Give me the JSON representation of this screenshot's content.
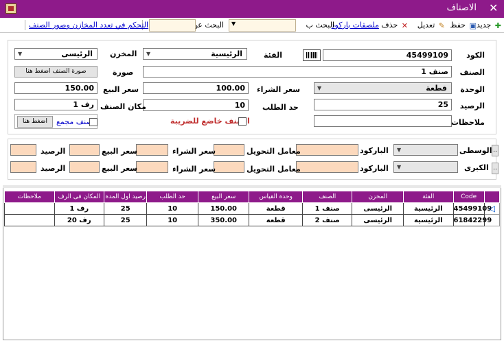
{
  "window": {
    "title": "الاصناف"
  },
  "toolbar": {
    "new": "جديد",
    "save": "حفظ",
    "edit": "تعديل",
    "delete": "حذف",
    "barcode_labels": "ملصقات باركود",
    "search_by": "البحث ب",
    "search_for": "البحث عن",
    "warehouse_control": "التحكم في تعدد المخازن وصور الصنف"
  },
  "form": {
    "code_label": "الكود",
    "code_value": "45499109",
    "category_label": "الفئة",
    "category_value": "الرئيسية",
    "store_label": "المخزن",
    "store_value": "الرئيسى",
    "item_label": "الصنف",
    "item_value": "صنف 1",
    "image_label": "صورة",
    "image_button": "صورة الصنف اضغط هنا",
    "unit_label": "الوحدة",
    "unit_value": "قطعة",
    "purchase_label": "سعر الشراء",
    "purchase_value": "100.00",
    "sale_label": "سعر البيع",
    "sale_value": "150.00",
    "balance_label": "الرصيد",
    "balance_value": "25",
    "reorder_label": "حد الطلب",
    "reorder_value": "10",
    "location_label": "مكان الصنف",
    "location_value": "رف 1",
    "notes_label": "ملاحظات",
    "notes_value": "",
    "taxable_label": "الصنف خاضع للضريبة",
    "compound_label": "صنف مجمع",
    "click_here": "اضغط هنا"
  },
  "units": [
    {
      "name": "الوسطى",
      "barcode_label": "الباركود",
      "factor_label": "معامل التحويل",
      "purchase_label": "سعر الشراء",
      "sale_label": "سعر البيع",
      "balance_label": "الرصيد"
    },
    {
      "name": "الكبرى",
      "barcode_label": "الباركود",
      "factor_label": "معامل التحويل",
      "purchase_label": "سعر الشراء",
      "sale_label": "سعر البيع",
      "balance_label": "الرصيد"
    }
  ],
  "grid": {
    "columns": [
      "Code",
      "الفئة",
      "المخزن",
      "الصنف",
      "وحدة القياس",
      "سعر البيع",
      "حد الطلب",
      "رصيد اول المدة",
      "المكان فى الرف",
      "ملاحظات"
    ],
    "rows": [
      [
        "45499109",
        "الرئيسية",
        "الرئيسى",
        "صنف 1",
        "قطعة",
        "150.00",
        "10",
        "25",
        "رف 1",
        ""
      ],
      [
        "61842299",
        "الرئيسية",
        "الرئيسى",
        "صنف 2",
        "قطعة",
        "350.00",
        "10",
        "25",
        "رف 20",
        ""
      ]
    ]
  },
  "colors": {
    "accent": "#8e1a8a",
    "highlight": "#fcd9bd",
    "link": "#0000cc"
  }
}
